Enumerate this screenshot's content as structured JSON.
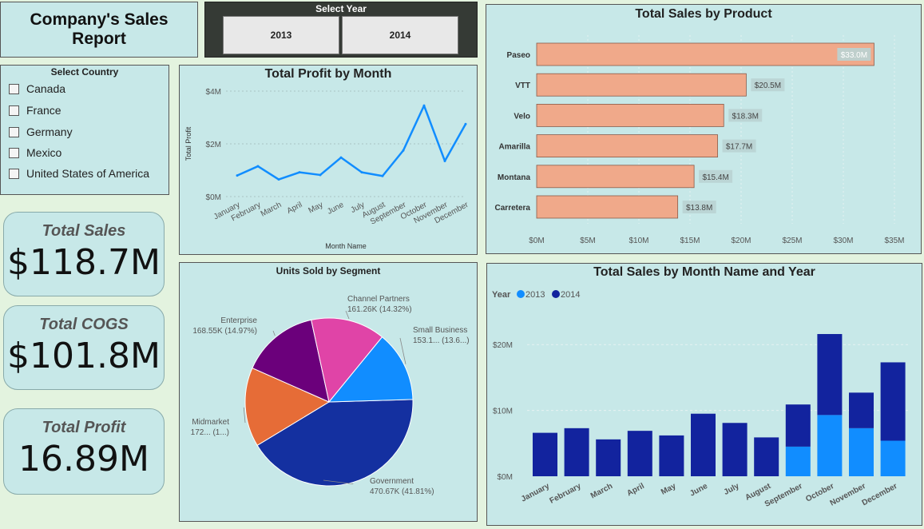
{
  "report_title": "Company's Sales Report",
  "year_slicer": {
    "label": "Select Year",
    "options": [
      "2013",
      "2014"
    ]
  },
  "country_slicer": {
    "label": "Select Country",
    "options": [
      "Canada",
      "France",
      "Germany",
      "Mexico",
      "United States of America"
    ]
  },
  "kpis": {
    "sales": {
      "title": "Total Sales",
      "value": "$118.7M"
    },
    "cogs": {
      "title": "Total COGS",
      "value": "$101.8M"
    },
    "profit": {
      "title": "Total Profit",
      "value": "16.89M"
    }
  },
  "colors": {
    "background": "#e3f3df",
    "panel": "#c7e8e8",
    "line": "#118dff",
    "bar_product": "#f0a98a",
    "series_2013": "#118dff",
    "series_2014": "#12239e",
    "pie": [
      "#1430a0",
      "#e66c37",
      "#6b007b",
      "#e044a7",
      "#118dff"
    ]
  },
  "chart_data": [
    {
      "id": "profit_by_month",
      "type": "line",
      "title": "Total Profit by Month",
      "xlabel": "Month Name",
      "ylabel": "Total Profit",
      "ylim": [
        0,
        4000000
      ],
      "yticks": [
        {
          "v": 0,
          "label": "$0M"
        },
        {
          "v": 2000000,
          "label": "$2M"
        },
        {
          "v": 4000000,
          "label": "$4M"
        }
      ],
      "categories": [
        "January",
        "February",
        "March",
        "April",
        "May",
        "June",
        "July",
        "August",
        "September",
        "October",
        "November",
        "December"
      ],
      "values": [
        800000,
        1150000,
        650000,
        920000,
        820000,
        1480000,
        920000,
        780000,
        1750000,
        3450000,
        1350000,
        2750000
      ]
    },
    {
      "id": "sales_by_product",
      "type": "bar",
      "orientation": "horizontal",
      "title": "Total Sales by Product",
      "categories": [
        "Paseo",
        "VTT",
        "Velo",
        "Amarilla",
        "Montana",
        "Carretera"
      ],
      "values": [
        33.0,
        20.5,
        18.3,
        17.7,
        15.4,
        13.8
      ],
      "value_labels": [
        "$33.0M",
        "$20.5M",
        "$18.3M",
        "$17.7M",
        "$15.4M",
        "$13.8M"
      ],
      "xlim": [
        0,
        35
      ],
      "xticks": [
        {
          "v": 0,
          "label": "$0M"
        },
        {
          "v": 5,
          "label": "$5M"
        },
        {
          "v": 10,
          "label": "$10M"
        },
        {
          "v": 15,
          "label": "$15M"
        },
        {
          "v": 20,
          "label": "$20M"
        },
        {
          "v": 25,
          "label": "$25M"
        },
        {
          "v": 30,
          "label": "$30M"
        },
        {
          "v": 35,
          "label": "$35M"
        }
      ]
    },
    {
      "id": "units_by_segment",
      "type": "pie",
      "title": "Units Sold by Segment",
      "slices": [
        {
          "name": "Government",
          "value": 470.67,
          "label": "Government",
          "detail": "470.67K (41.81%)"
        },
        {
          "name": "Midmarket",
          "value": 172.0,
          "label": "Midmarket",
          "detail": "172... (1...)"
        },
        {
          "name": "Enterprise",
          "value": 168.55,
          "label": "Enterprise",
          "detail": "168.55K (14.97%)"
        },
        {
          "name": "Channel Partners",
          "value": 161.26,
          "label": "Channel Partners",
          "detail": "161.26K (14.32%)"
        },
        {
          "name": "Small Business",
          "value": 153.1,
          "label": "Small Business",
          "detail": "153.1... (13.6...)"
        }
      ]
    },
    {
      "id": "sales_by_month_year",
      "type": "bar",
      "stacked": true,
      "title": "Total Sales by Month Name and Year",
      "legend_title": "Year",
      "ylim": [
        0,
        25
      ],
      "yticks": [
        {
          "v": 0,
          "label": "$0M"
        },
        {
          "v": 10,
          "label": "$10M"
        },
        {
          "v": 20,
          "label": "$20M"
        }
      ],
      "categories": [
        "January",
        "February",
        "March",
        "April",
        "May",
        "June",
        "July",
        "August",
        "September",
        "October",
        "November",
        "December"
      ],
      "series": [
        {
          "name": "2013",
          "values": [
            0,
            0,
            0,
            0,
            0,
            0,
            0,
            0,
            4.5,
            9.3,
            7.3,
            5.4
          ]
        },
        {
          "name": "2014",
          "values": [
            6.6,
            7.3,
            5.6,
            6.9,
            6.2,
            9.5,
            8.1,
            5.9,
            6.4,
            12.3,
            5.4,
            11.9
          ]
        }
      ]
    }
  ]
}
